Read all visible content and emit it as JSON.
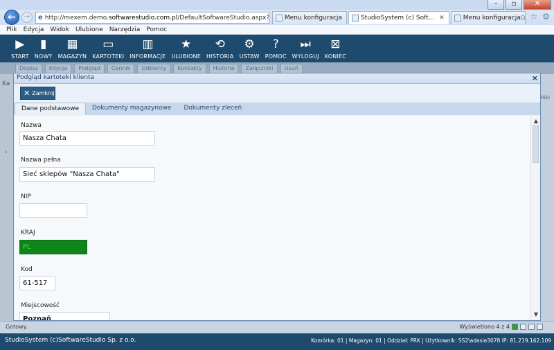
{
  "browser": {
    "url_prefix": "http://mexem.demo.",
    "url_host": "softwarestudio.com.pl",
    "url_path": "/DefaultSoftwareStudio.aspx?rola=MI",
    "tabs": [
      {
        "label": "Menu konfiguracja",
        "active": false
      },
      {
        "label": "StudioSystem (c) Soft...",
        "active": true
      },
      {
        "label": "Menu konfiguracja",
        "active": false
      }
    ],
    "menu": [
      "Plik",
      "Edycja",
      "Widok",
      "Ulubione",
      "Narzędzia",
      "Pomoc"
    ]
  },
  "toolbar": {
    "items": [
      {
        "label": "START",
        "icon": "play-icon"
      },
      {
        "label": "NOWY",
        "icon": "document-icon"
      },
      {
        "label": "MAGAZYN",
        "icon": "warehouse-icon"
      },
      {
        "label": "KARTOTEKI",
        "icon": "monitor-icon"
      },
      {
        "label": "INFORMACJE",
        "icon": "chart-icon"
      },
      {
        "label": "ULUBIONE",
        "icon": "star-icon"
      },
      {
        "label": "HISTORIA",
        "icon": "history-icon"
      },
      {
        "label": "USTAW",
        "icon": "gear-icon"
      },
      {
        "label": "POMOC",
        "icon": "help-icon"
      },
      {
        "label": "WYLOGUJ",
        "icon": "logout-icon"
      },
      {
        "label": "KONIEC",
        "icon": "exit-icon"
      }
    ],
    "secondary": [
      "Dopisz",
      "Edycja",
      "Podgląd",
      "Cennik",
      "Odbiorcy",
      "Kontakty",
      "Historia",
      "Załączniki",
      "Usuń"
    ]
  },
  "underlay": {
    "left_label": "Ka",
    "right_label": "FED"
  },
  "modal": {
    "title": "Podgląd kartoteki klienta",
    "close_label": "Zamknij",
    "tabs": [
      "Dane podstawowe",
      "Dokumenty magazynowe",
      "Dokumenty zleceń"
    ],
    "fields": [
      {
        "label": "Nazwa",
        "value": "Nasza Chata"
      },
      {
        "label": "Nazwa pełna",
        "value": "Sieć sklepów \"Nasza Chata\""
      },
      {
        "label": "NIP",
        "value": ""
      },
      {
        "label": "KRAJ",
        "value": "PL"
      },
      {
        "label": "Kod",
        "value": "61-517"
      },
      {
        "label": "Miejscowość",
        "value": "Poznań"
      }
    ]
  },
  "status": {
    "ready": "Gotowy.",
    "displayed": "Wyświetlono 4 z 4"
  },
  "footer": {
    "company": "StudioSystem (c)SoftwareStudio Sp. z o.o.",
    "info": "Komórka: 01 | Magazyn: 01 | Oddział: PRK | Użytkownik: SS2\\adasie3078 IP: 81.219.162.109"
  }
}
